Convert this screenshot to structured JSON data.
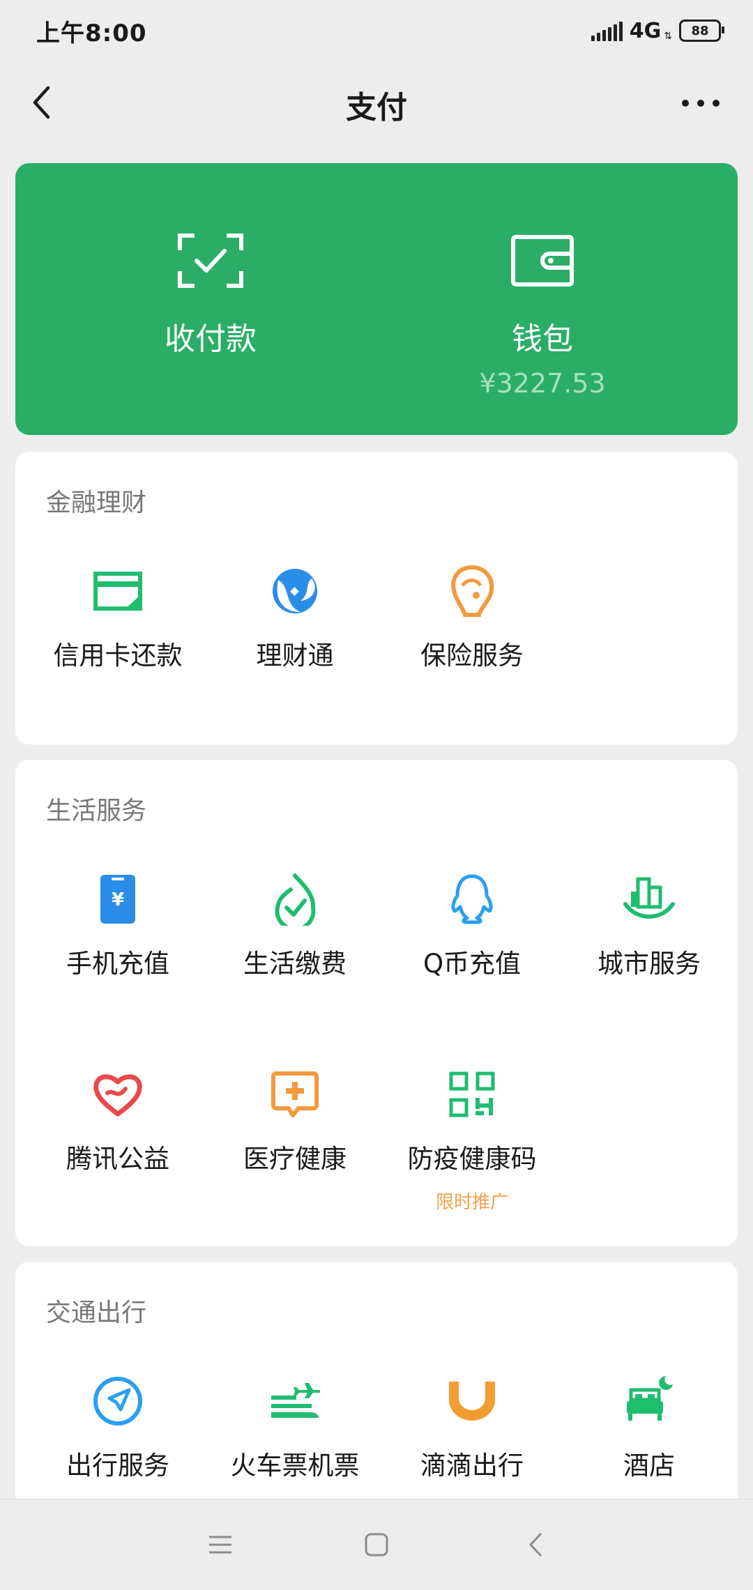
{
  "status_bar": {
    "time": "上午8:00",
    "network": "4G",
    "battery": "88"
  },
  "nav": {
    "title": "支付"
  },
  "wallet_card": {
    "pay_label": "收付款",
    "wallet_label": "钱包",
    "wallet_balance": "¥3227.53",
    "color": "#2aae67"
  },
  "finance": {
    "title": "金融理财",
    "items": [
      {
        "label": "信用卡还款",
        "icon": "credit-card-icon"
      },
      {
        "label": "理财通",
        "icon": "wealth-icon"
      },
      {
        "label": "保险服务",
        "icon": "insurance-icon"
      }
    ]
  },
  "life": {
    "title": "生活服务",
    "items": [
      {
        "label": "手机充值",
        "icon": "phone-topup-icon"
      },
      {
        "label": "生活缴费",
        "icon": "utility-bill-icon"
      },
      {
        "label": "Q币充值",
        "icon": "qq-penguin-icon"
      },
      {
        "label": "城市服务",
        "icon": "city-service-icon"
      },
      {
        "label": "腾讯公益",
        "icon": "charity-heart-icon"
      },
      {
        "label": "医疗健康",
        "icon": "medical-icon"
      },
      {
        "label": "防疫健康码",
        "icon": "qr-code-icon",
        "promo": "限时推广"
      }
    ]
  },
  "transport": {
    "title": "交通出行",
    "items": [
      {
        "label": "出行服务",
        "icon": "navigation-icon"
      },
      {
        "label": "火车票机票",
        "icon": "train-plane-icon"
      },
      {
        "label": "滴滴出行",
        "icon": "didi-icon"
      },
      {
        "label": "酒店",
        "icon": "hotel-bed-icon"
      }
    ]
  }
}
